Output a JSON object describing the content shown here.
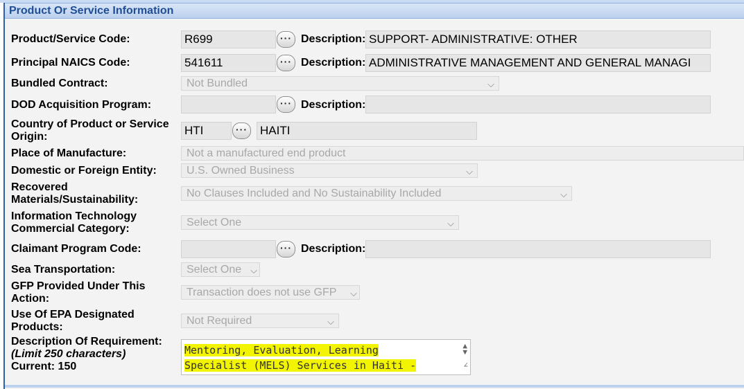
{
  "header": {
    "title": "Product Or Service Information"
  },
  "fields": {
    "psc": {
      "label": "Product/Service Code:",
      "code": "R699",
      "desc_label": "Description:",
      "desc": "SUPPORT- ADMINISTRATIVE: OTHER"
    },
    "naics": {
      "label": "Principal NAICS Code:",
      "code": "541611",
      "desc_label": "Description:",
      "desc": "ADMINISTRATIVE MANAGEMENT AND GENERAL MANAGI"
    },
    "bundled": {
      "label": "Bundled Contract:",
      "value": "Not Bundled"
    },
    "dod": {
      "label": "DOD Acquisition Program:",
      "code": "",
      "desc_label": "Description:",
      "desc": ""
    },
    "country": {
      "label_1": "Country of Product or Service",
      "label_2": "Origin:",
      "code": "HTI",
      "name": "HAITI"
    },
    "manufacture": {
      "label": "Place of Manufacture:",
      "value": "Not a manufactured end product"
    },
    "domestic": {
      "label": "Domestic or Foreign Entity:",
      "value": "U.S. Owned Business"
    },
    "recovered": {
      "label_1": "Recovered",
      "label_2": "Materials/Sustainability:",
      "value": "No Clauses Included and No Sustainability Included"
    },
    "it": {
      "label_1": "Information Technology",
      "label_2": "Commercial Category:",
      "value": "Select One"
    },
    "claimant": {
      "label": "Claimant Program Code:",
      "code": "",
      "desc_label": "Description:",
      "desc": ""
    },
    "sea": {
      "label": "Sea Transportation:",
      "value": "Select One"
    },
    "gfp": {
      "label_1": "GFP Provided Under This",
      "label_2": "Action:",
      "value": "Transaction does not use GFP"
    },
    "epa": {
      "label_1": "Use Of EPA Designated",
      "label_2": "Products:",
      "value": "Not Required"
    },
    "requirement": {
      "label_1": "Description Of Requirement:",
      "label_2": "(Limit 250 characters)",
      "label_3": "Current: 150",
      "line_1": "Mentoring, Evaluation, Learning",
      "line_2": "Specialist (MELS) Services in Haiti -"
    }
  },
  "icons": {
    "lookup": "ellipsis-lookup-icon",
    "dropdown": "chevron-down-icon",
    "spinner": "spinner-arrows-icon",
    "resize": "resize-grip-icon"
  },
  "colors": {
    "header_text": "#1f4e95",
    "highlight": "#f3f400",
    "panel_border": "#2d5fae"
  }
}
